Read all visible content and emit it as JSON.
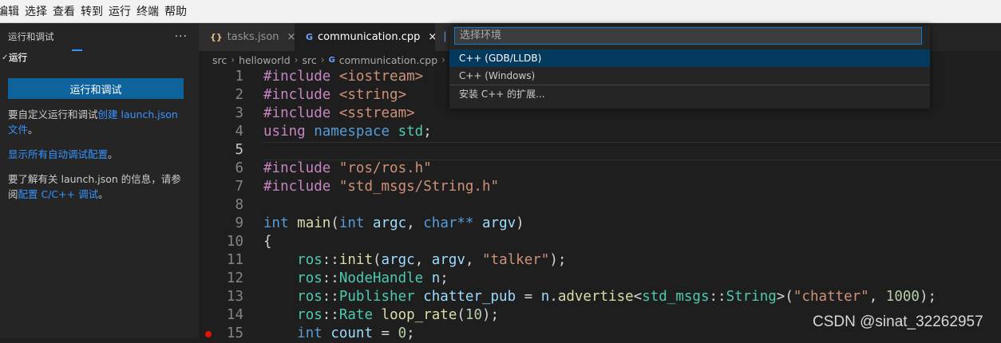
{
  "menubar": {
    "items": [
      "编辑",
      "选择",
      "查看",
      "转到",
      "运行",
      "终端",
      "帮助"
    ]
  },
  "sidebar": {
    "title": "运行和调试",
    "more_icon": "more-horizontal-icon",
    "section_title": "运行",
    "run_button": "运行和调试",
    "para1_text": "要自定义运行和调试",
    "para1_link": "创建 launch.json",
    "para1_link2": "文件",
    "para1_end": "。",
    "para2_link": "显示所有自动调试配置",
    "para2_end": "。",
    "para3_text": "要了解有关 launch.json 的信息，请参阅",
    "para3_link": "配置 C/C++ 调试",
    "para3_end": "。"
  },
  "tabs": [
    {
      "label": "tasks.json",
      "icon": "{}",
      "close": "×"
    },
    {
      "label": "communication.cpp",
      "icon": "G",
      "close": "×"
    }
  ],
  "breadcrumb": [
    "src",
    "helloworld",
    "src",
    "communication.cpp"
  ],
  "quickpick": {
    "placeholder": "选择环境",
    "items": [
      "C++ (GDB/LLDB)",
      "C++ (Windows)",
      "安装 C++ 的扩展..."
    ],
    "selected_index": 0
  },
  "editor": {
    "active_line": 5,
    "breakpoint_line": 15,
    "line_numbers": [
      "1",
      "2",
      "3",
      "4",
      "5",
      "6",
      "7",
      "8",
      "9",
      "10",
      "11",
      "12",
      "13",
      "14",
      "15"
    ]
  },
  "watermark": "CSDN @sinat_32262957",
  "colors": {
    "accent": "#0e639c",
    "link": "#3794ff",
    "selection": "#04395e",
    "breakpoint": "#e51400"
  }
}
